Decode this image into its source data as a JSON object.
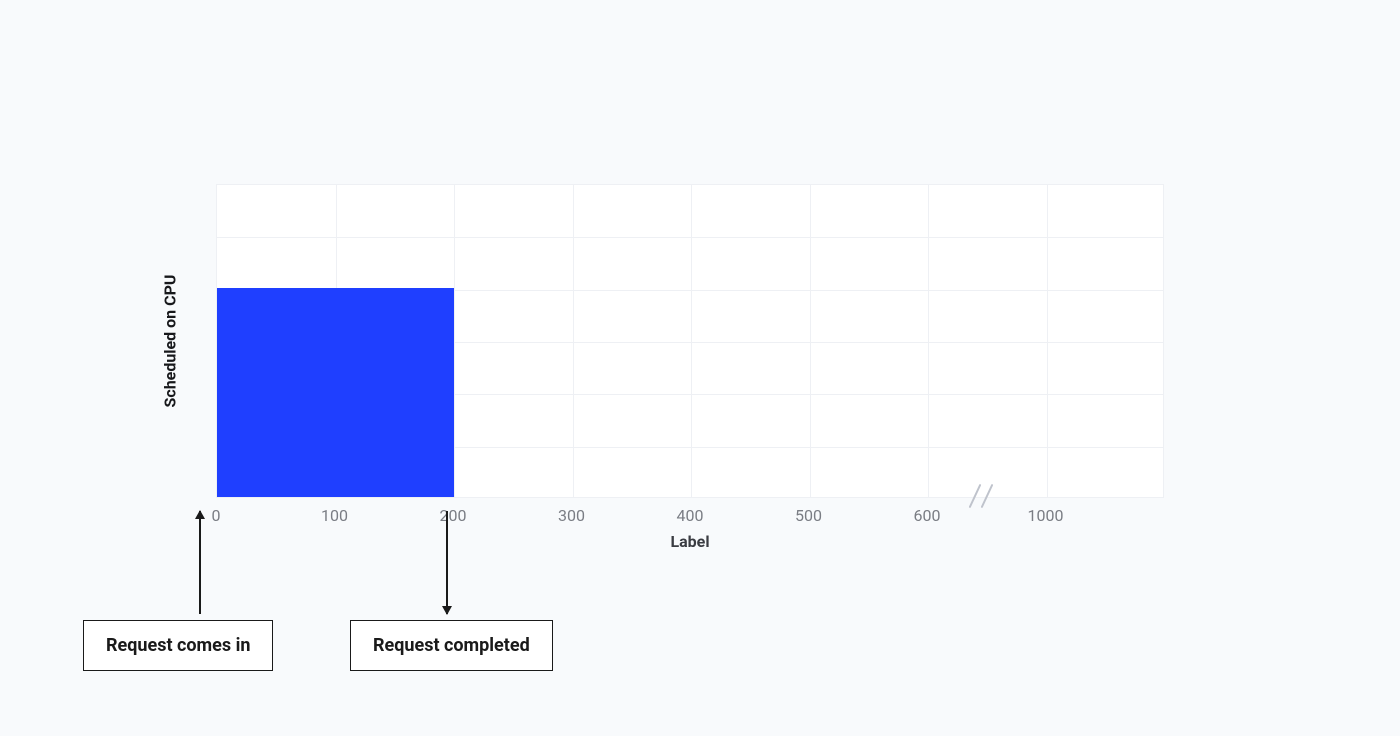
{
  "chart_data": {
    "type": "bar",
    "title": "",
    "xlabel": "Label",
    "ylabel": "Scheduled on CPU",
    "x_ticks": [
      "0",
      "100",
      "200",
      "300",
      "400",
      "500",
      "600",
      "1000"
    ],
    "x_range": [
      0,
      1000
    ],
    "y_range": [
      0,
      6
    ],
    "series": [
      {
        "name": "Scheduled on CPU",
        "start": 0,
        "end": 200,
        "height_fraction": 0.666
      }
    ],
    "axis_break_between": [
      600,
      1000
    ],
    "annotations": [
      {
        "x": 0,
        "label": "Request comes in",
        "direction": "up"
      },
      {
        "x": 200,
        "label": "Request completed",
        "direction": "down"
      }
    ],
    "colors": {
      "bar": "#1f3fff",
      "grid": "#eef0f4",
      "tick": "#7a7d84"
    }
  },
  "ui": {
    "xlabel": "Label",
    "ylabel": "Scheduled on CPU",
    "ticks": {
      "t0": "0",
      "t1": "100",
      "t2": "200",
      "t3": "300",
      "t4": "400",
      "t5": "500",
      "t6": "600",
      "t7": "1000"
    },
    "callout_in": "Request comes in",
    "callout_done": "Request completed"
  }
}
